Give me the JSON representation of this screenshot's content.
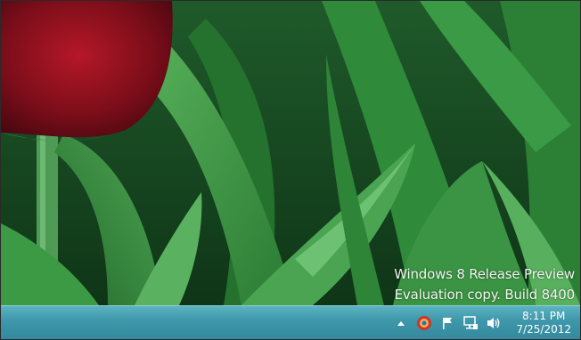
{
  "desktop": {
    "watermark_line1": "Windows 8 Release Preview",
    "watermark_line2": "Evaluation copy. Build 8400"
  },
  "taskbar": {
    "tray_icons": [
      "show-hidden-icons-chevron",
      "app-icon",
      "action-center-flag",
      "network-icon",
      "volume-icon"
    ],
    "clock": {
      "time": "8:11 PM",
      "date": "7/25/2012"
    }
  },
  "colors": {
    "taskbar": "#3f98ab",
    "watermark_text": "#f1f7ef"
  }
}
